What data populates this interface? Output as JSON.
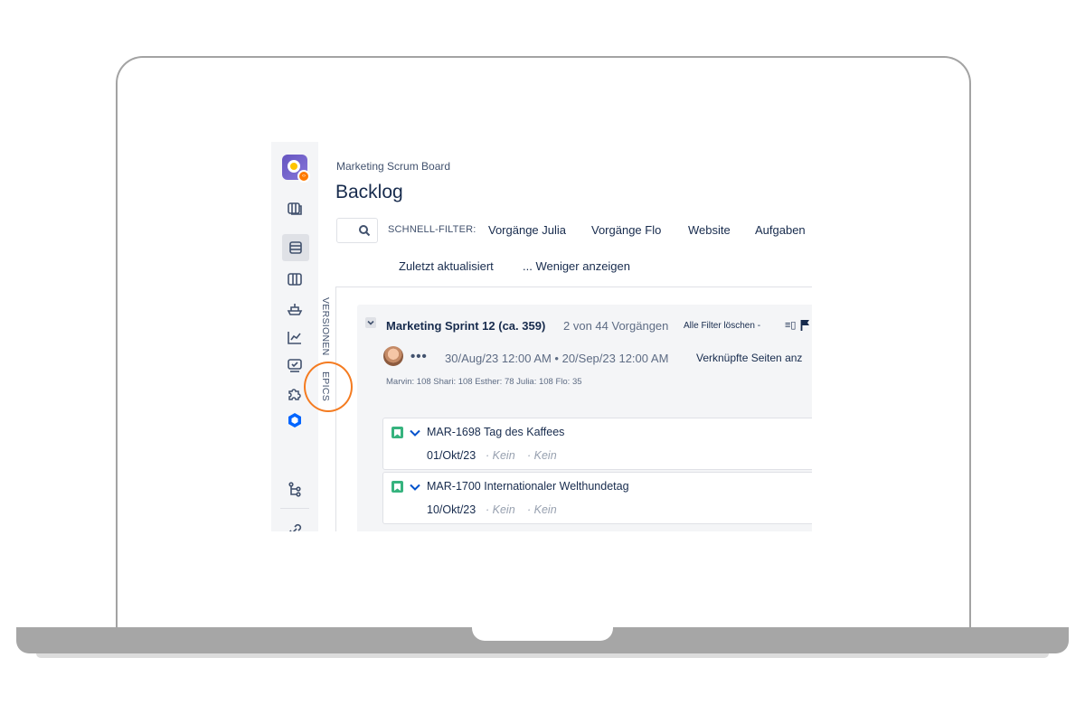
{
  "header": {
    "breadcrumb": "Marketing Scrum Board",
    "title": "Backlog"
  },
  "quick_filters": {
    "label": "SCHNELL-FILTER:",
    "items": [
      "Vorgänge Julia",
      "Vorgänge Flo",
      "Website",
      "Aufgaben",
      "Zuletzt aktualisiert",
      "... Weniger anzeigen"
    ]
  },
  "side_tabs": {
    "versions": "VERSIONEN",
    "epics": "EPICS"
  },
  "sprint": {
    "name": "Marketing Sprint 12 (ca. 359)",
    "count": "2 von 44 Vorgängen",
    "clear_filters": "Alle Filter löschen -",
    "tools": "≡▯",
    "more": "•••",
    "dates": "30/Aug/23 12:00 AM • 20/Sep/23 12:00 AM",
    "linked_pages": "Verknüpfte Seiten anz",
    "assignee_stats": "Marvin: 108 Shari: 108 Esther: 78 Julia: 108 Flo: 35"
  },
  "issues": [
    {
      "key": "MAR-1698",
      "title": "Tag des Kaffees",
      "date": "01/Okt/23",
      "meta1": "· Kein",
      "meta2": "· Kein"
    },
    {
      "key": "MAR-1700",
      "title": "Internationaler Welthundetag",
      "date": "10/Okt/23",
      "meta1": "· Kein",
      "meta2": "· Kein"
    }
  ],
  "icons": {
    "rail": [
      "app-logo",
      "board-icon",
      "backlog-icon",
      "active-sprints-icon",
      "releases-icon",
      "reports-icon",
      "issues-icon",
      "add-ons-icon",
      "app-cube-icon",
      "tree-icon",
      "link-icon"
    ]
  },
  "colors": {
    "highlight": "#f47b20",
    "story": "#36b37e",
    "priority": "#0052cc"
  }
}
